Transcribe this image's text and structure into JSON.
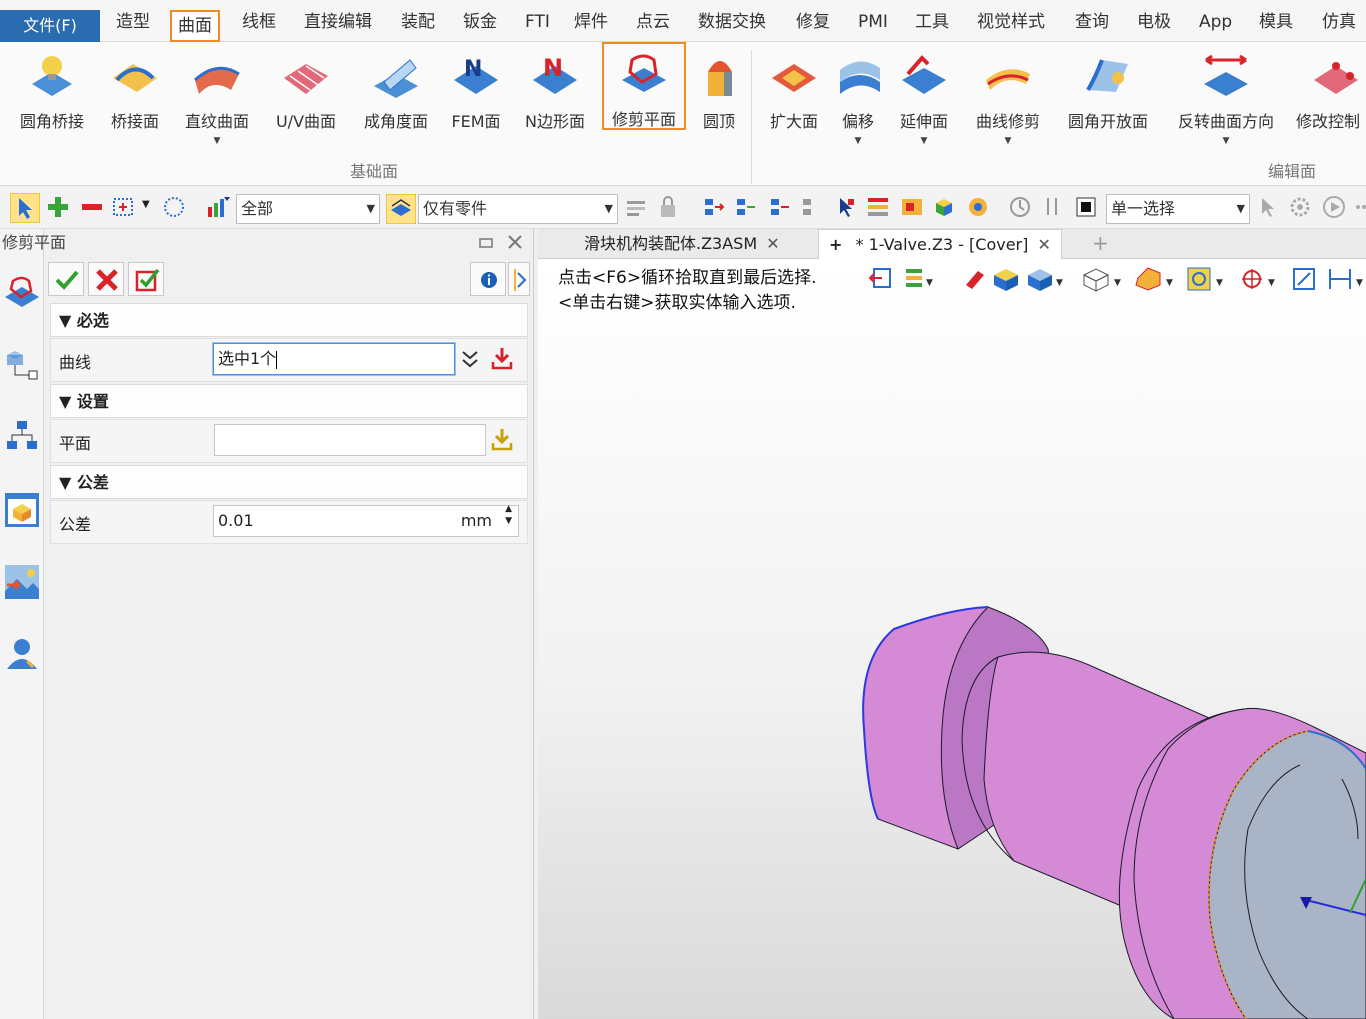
{
  "menubar": {
    "items": [
      "文件(F)",
      "造型",
      "曲面",
      "线框",
      "直接编辑",
      "装配",
      "钣金",
      "FTI",
      "焊件",
      "点云",
      "数据交换",
      "修复",
      "PMI",
      "工具",
      "视觉样式",
      "查询",
      "电极",
      "App",
      "模具",
      "仿真"
    ],
    "active": "曲面"
  },
  "ribbon": {
    "basic": [
      "圆角桥接",
      "桥接面",
      "直纹曲面",
      "U/V曲面",
      "成角度面",
      "FEM面",
      "N边形面",
      "修剪平面",
      "圆顶"
    ],
    "basic_group": "基础面",
    "edit": [
      "扩大面",
      "偏移",
      "延伸面",
      "曲线修剪",
      "圆角开放面",
      "反转曲面方向",
      "修改控制"
    ],
    "edit_group": "编辑面",
    "highlighted": "修剪平面"
  },
  "toolbar": {
    "filter_value": "全部",
    "part_filter_value": "仅有零件",
    "selection_mode": "单一选择"
  },
  "panel": {
    "title": "修剪平面",
    "required_section": "必选",
    "curve_label": "曲线",
    "curve_value": "选中1个",
    "settings_section": "设置",
    "plane_label": "平面",
    "plane_value": "",
    "tolerance_section": "公差",
    "tolerance_label": "公差",
    "tolerance_value": "0.01",
    "tolerance_unit": "mm"
  },
  "tabs": {
    "tab1": "滑块机构装配体.Z3ASM",
    "tab2": "* 1-Valve.Z3 - [Cover]"
  },
  "viewport": {
    "hint1": "点击<F6>循环拾取直到最后选择.",
    "hint2": "<单击右键>获取实体输入选项.",
    "part_color": "#d58ad6",
    "face_color": "#a9b5c6"
  }
}
